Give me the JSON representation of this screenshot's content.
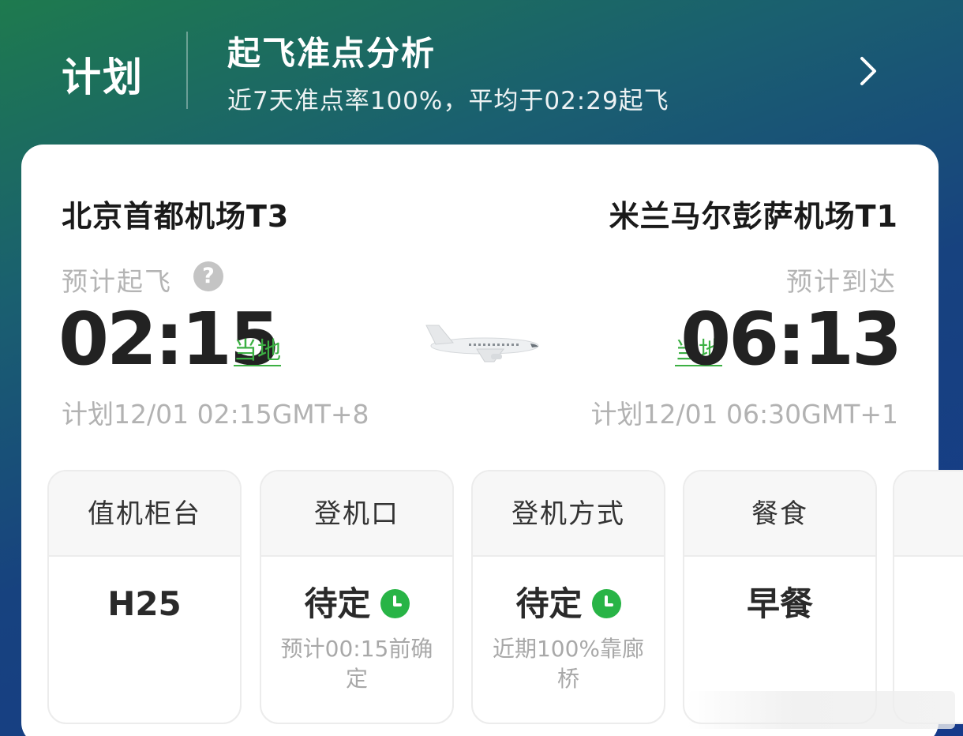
{
  "header": {
    "plan_label": "计划",
    "ontime_title": "起飞准点分析",
    "ontime_subtitle": "近7天准点率100%，平均于02:29起飞"
  },
  "departure": {
    "airport": "北京首都机场T3",
    "label": "预计起飞",
    "time": "02:15",
    "local_tag": "当地",
    "planned": "计划12/01 02:15GMT+8"
  },
  "arrival": {
    "airport": "米兰马尔彭萨机场T1",
    "label": "预计到达",
    "time": "06:13",
    "local_tag": "当地",
    "planned": "计划12/01 06:30GMT+1"
  },
  "info_cards": [
    {
      "title": "值机柜台",
      "value": "H25",
      "note": ""
    },
    {
      "title": "登机口",
      "value": "待定",
      "note": "预计00:15前确定"
    },
    {
      "title": "登机方式",
      "value": "待定",
      "note": "近期100%靠廊桥"
    },
    {
      "title": "餐食",
      "value": "早餐",
      "note": ""
    }
  ],
  "icons": {
    "chevron": "chevron-right-icon",
    "help": "question-icon",
    "plane": "airplane-icon",
    "clock": "clock-icon"
  },
  "colors": {
    "accent_green": "#3cb043",
    "clock_green": "#28b446"
  }
}
